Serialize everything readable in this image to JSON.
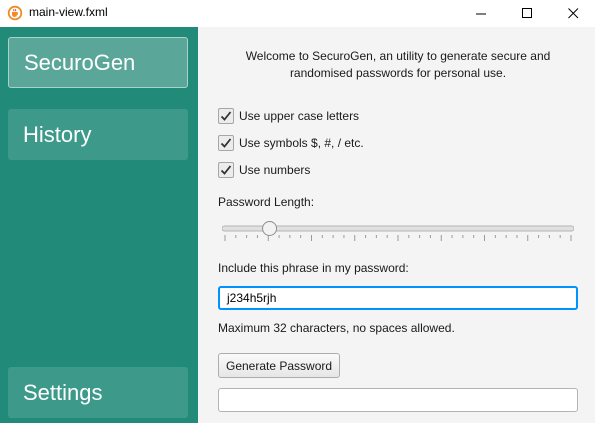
{
  "window": {
    "title": "main-view.fxml",
    "icon": "java-cup-icon"
  },
  "sidebar": {
    "items": [
      {
        "label": "SecuroGen",
        "active": true
      },
      {
        "label": "History",
        "active": false
      },
      {
        "label": "Settings",
        "active": false
      }
    ]
  },
  "main": {
    "welcome_line1": "Welcome to SecuroGen, an utility to generate secure and",
    "welcome_line2": "randomised passwords for personal use.",
    "options": [
      {
        "label": "Use upper case letters",
        "checked": true
      },
      {
        "label": "Use symbols $, #, / etc.",
        "checked": true
      },
      {
        "label": "Use numbers",
        "checked": true
      }
    ],
    "length_label": "Password Length:",
    "length_slider_fraction": 0.12,
    "phrase_label": "Include this phrase in my password:",
    "phrase_value": "j234h5rjh",
    "phrase_note": "Maximum 32 characters, no spaces allowed.",
    "generate_label": "Generate Password",
    "output_value": ""
  },
  "colors": {
    "sidebar_bg": "#228a79",
    "focus_blue": "#0093ff"
  }
}
